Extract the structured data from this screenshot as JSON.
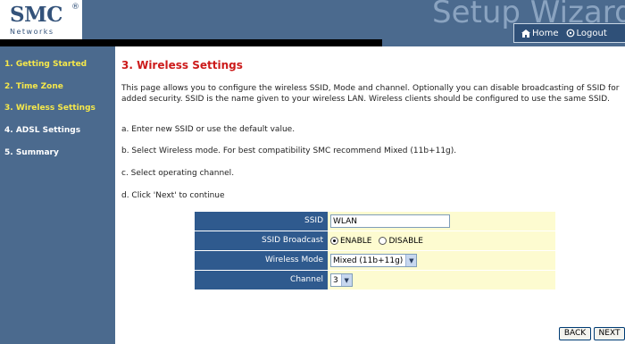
{
  "header": {
    "logo": "SMC",
    "logo_mark": "®",
    "logo_sub": "Networks",
    "wizard_title": "Setup Wizard",
    "home_label": "Home",
    "logout_label": "Logout"
  },
  "sidebar": {
    "items": [
      {
        "label": "1. Getting Started",
        "state": "done"
      },
      {
        "label": "2. Time Zone",
        "state": "done"
      },
      {
        "label": "3. Wireless Settings",
        "state": "current"
      },
      {
        "label": "4. ADSL Settings",
        "state": "pending"
      },
      {
        "label": "5. Summary",
        "state": "pending"
      }
    ]
  },
  "main": {
    "title": "3. Wireless Settings",
    "intro": "This page allows you to configure the wireless SSID, Mode and channel. Optionally you can disable broadcasting of SSID for added security. SSID is the name given to your wireless LAN. Wireless clients should be configured to use the same SSID.",
    "step_a": "a. Enter new SSID or use the default value.",
    "step_b": "b. Select Wireless mode. For best compatibility SMC recommend Mixed (11b+11g).",
    "step_c": "c. Select operating channel.",
    "step_d": "d. Click 'Next' to continue"
  },
  "form": {
    "ssid_label": "SSID",
    "ssid_value": "WLAN",
    "broadcast_label": "SSID Broadcast",
    "broadcast_enable": "ENABLE",
    "broadcast_disable": "DISABLE",
    "broadcast_selected": "ENABLE",
    "mode_label": "Wireless Mode",
    "mode_value": "Mixed (11b+11g)",
    "channel_label": "Channel",
    "channel_value": "3"
  },
  "buttons": {
    "back": "BACK",
    "next": "NEXT"
  },
  "colors": {
    "sidebar_bg": "#4b6a8e",
    "title_red": "#cc1a1a",
    "label_blue": "#2f5a8e",
    "value_yellow": "#fdfbd0",
    "nav_yellow": "#f6e84a"
  }
}
